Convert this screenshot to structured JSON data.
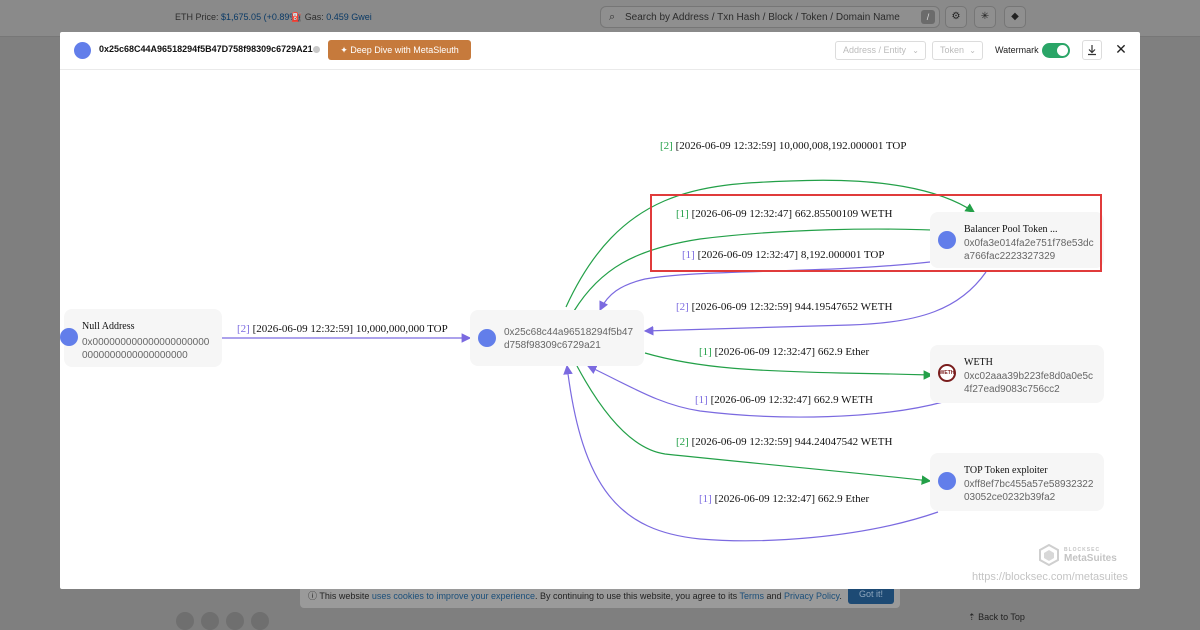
{
  "background": {
    "eth_price_label": "ETH Price:",
    "eth_price_value": "$1,675.05 (+0.89%)",
    "gas_label": "Gas:",
    "gas_value": "0.459 Gwei",
    "search_placeholder": "Search by Address / Txn Hash / Block / Token / Domain Name",
    "search_shortcut": "/",
    "cookie_text_1": "This website",
    "cookie_link_1": "uses cookies to improve your experience",
    "cookie_text_2": ". By continuing to use this website, you agree to its",
    "cookie_link_2": "Terms",
    "cookie_text_3": "and",
    "cookie_link_3": "Privacy Policy",
    "cookie_button": "Got it!",
    "back_to_top": "Back to Top"
  },
  "modal": {
    "title_address": "0x25c68C44A96518294f5B47D758f98309c6729A21",
    "deep_dive_button": "Deep Dive with MetaSleuth",
    "filter_address_placeholder": "Address / Entity",
    "filter_token_placeholder": "Token",
    "watermark_label": "Watermark",
    "watermark_on": true,
    "close_icon": "close-icon",
    "download_icon": "download-icon"
  },
  "graph": {
    "nodes": {
      "null": {
        "name": "Null Address",
        "address": "0x0000000000000000000000000000000000000000"
      },
      "center": {
        "address": "0x25c68c44a96518294f5b47d758f98309c6729a21"
      },
      "balancer": {
        "name": "Balancer Pool Token ...",
        "address": "0x0fa3e014fa2e751f78e53dca766fac2223327329"
      },
      "weth": {
        "name": "WETH",
        "address": "0xc02aaa39b223fe8d0a0e5c4f27ead9083c756cc2",
        "icon_text": "WETH"
      },
      "exploiter": {
        "name": "TOP Token exploiter",
        "address": "0xff8ef7bc455a57e5893232203052ce0232b39fa2"
      }
    },
    "edges": {
      "e_null_center": {
        "count": "[2]",
        "text": "[2026-06-09 12:32:59] 10,000,000,000 TOP"
      },
      "e_center_bal_top": {
        "count": "[2]",
        "text": "[2026-06-09 12:32:59] 10,000,008,192.000001 TOP"
      },
      "e_center_bal_weth": {
        "count": "[1]",
        "text": "[2026-06-09 12:32:47] 662.85500109 WETH"
      },
      "e_bal_center_top": {
        "count": "[1]",
        "text": "[2026-06-09 12:32:47] 8,192.000001 TOP"
      },
      "e_bal_center_weth": {
        "count": "[2]",
        "text": "[2026-06-09 12:32:59] 944.19547652 WETH"
      },
      "e_center_weth_ether": {
        "count": "[1]",
        "text": "[2026-06-09 12:32:47] 662.9 Ether"
      },
      "e_weth_center_weth": {
        "count": "[1]",
        "text": "[2026-06-09 12:32:47] 662.9 WETH"
      },
      "e_center_expl_weth": {
        "count": "[2]",
        "text": "[2026-06-09 12:32:59] 944.24047542 WETH"
      },
      "e_expl_center_ether": {
        "count": "[1]",
        "text": "[2026-06-09 12:32:47] 662.9 Ether"
      }
    },
    "colors": {
      "outgoing": "#23a048",
      "incoming": "#7b6ae0",
      "highlight": "#e03b3b"
    },
    "watermark_brand_top": "BLOCKSEC",
    "watermark_brand": "MetaSuites",
    "watermark_url": "https://blocksec.com/metasuites"
  }
}
